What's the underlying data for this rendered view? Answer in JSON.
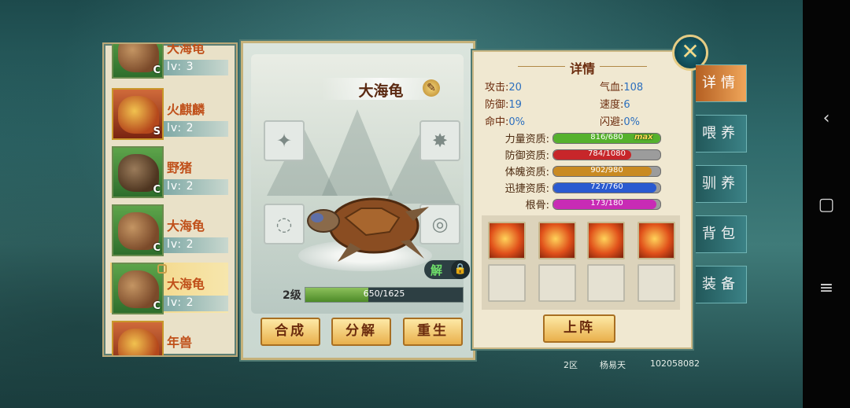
{
  "pet_list": [
    {
      "name": "大海龟",
      "level": "lv: 3",
      "grade": "C",
      "kind": "turtle"
    },
    {
      "name": "火麒麟",
      "level": "lv: 2",
      "grade": "S",
      "kind": "dragon"
    },
    {
      "name": "野猪",
      "level": "lv: 2",
      "grade": "C",
      "kind": "boar"
    },
    {
      "name": "大海龟",
      "level": "lv: 2",
      "grade": "C",
      "kind": "turtle"
    },
    {
      "name": "大海龟",
      "level": "lv: 2",
      "grade": "C",
      "kind": "turtle",
      "selected": true
    },
    {
      "name": "年兽",
      "level": "",
      "grade": "",
      "kind": "dragon"
    }
  ],
  "detail_pet": {
    "name": "大海龟",
    "level_label": "2级",
    "xp_text": "650/1625",
    "xp_fraction": 0.4,
    "unlock_label": "解"
  },
  "actions": {
    "combine": "合成",
    "decompose": "分解",
    "rebirth": "重生",
    "deploy": "上阵"
  },
  "details": {
    "title": "详情",
    "attack": {
      "label": "攻击:",
      "value": "20"
    },
    "hp": {
      "label": "气血:",
      "value": "108"
    },
    "defense": {
      "label": "防御:",
      "value": "19"
    },
    "speed": {
      "label": "速度:",
      "value": "6"
    },
    "hit": {
      "label": "命中:",
      "value": "0%"
    },
    "dodge": {
      "label": "闪避:",
      "value": "0%"
    }
  },
  "aptitudes": [
    {
      "label": "力量资质:",
      "text": "816/680",
      "fraction": 1.0,
      "color": "#55b12d",
      "max": "max"
    },
    {
      "label": "防御资质:",
      "text": "784/1080",
      "fraction": 0.73,
      "color": "#c7262a",
      "max": ""
    },
    {
      "label": "体魄资质:",
      "text": "902/980",
      "fraction": 0.92,
      "color": "#c98a22",
      "max": ""
    },
    {
      "label": "迅捷资质:",
      "text": "727/760",
      "fraction": 0.96,
      "color": "#2a5ad0",
      "max": ""
    },
    {
      "label": "根骨:",
      "text": "173/180",
      "fraction": 0.96,
      "color": "#c82bb5",
      "max": ""
    }
  ],
  "tabs": [
    "详情",
    "喂养",
    "驯养",
    "背包",
    "装备"
  ],
  "footer": {
    "server": "2区",
    "player": "杨易天",
    "id": "102058082"
  },
  "icons": {
    "close": "close-icon",
    "edit": "edit-icon",
    "lock": "lock-icon"
  }
}
